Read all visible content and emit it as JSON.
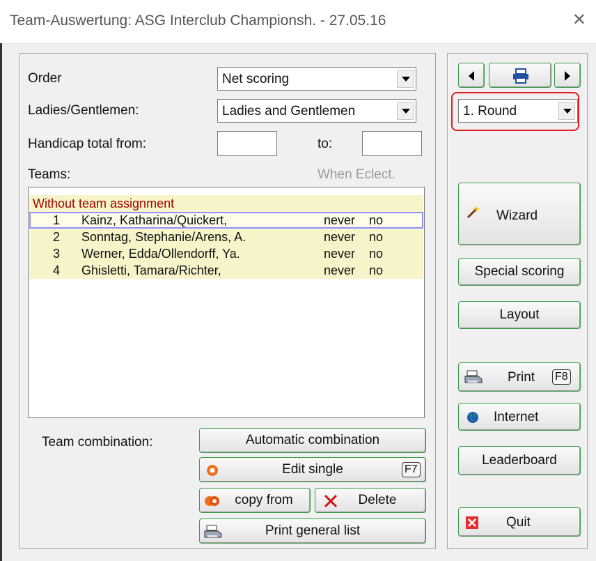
{
  "window": {
    "title": "Team-Auswertung: ASG Interclub Championsh. - 27.05.16",
    "close_glyph": "✕"
  },
  "form": {
    "order_label": "Order",
    "order_value": "Net scoring",
    "gender_label": "Ladies/Gentlemen:",
    "gender_value": "Ladies and Gentlemen",
    "handicap_label": "Handicap total from:",
    "handicap_from": "",
    "to_label": "to:",
    "handicap_to": ""
  },
  "teams": {
    "label": "Teams:",
    "when_eclect_label": "When Eclect.",
    "group_header": "Without team assignment",
    "rows": [
      {
        "num": "1",
        "name": "Kainz, Katharina/Quickert,",
        "when": "never",
        "eclect": "no"
      },
      {
        "num": "2",
        "name": "Sonntag, Stephanie/Arens, A.",
        "when": "never",
        "eclect": "no"
      },
      {
        "num": "3",
        "name": "Werner, Edda/Ollendorff, Ya.",
        "when": "never",
        "eclect": "no"
      },
      {
        "num": "4",
        "name": "Ghisletti, Tamara/Richter,",
        "when": "never",
        "eclect": "no"
      }
    ]
  },
  "combination": {
    "label": "Team combination:",
    "automatic": "Automatic combination",
    "edit_single": "Edit single",
    "edit_single_key": "F7",
    "copy_from": "copy from",
    "delete": "Delete",
    "print_general": "Print general list"
  },
  "side": {
    "round_value": "1. Round",
    "wizard": "Wizard",
    "special_scoring": "Special scoring",
    "layout": "Layout",
    "print": "Print",
    "print_key": "F8",
    "internet": "Internet",
    "leaderboard": "Leaderboard",
    "quit": "Quit"
  },
  "colors": {
    "accent_green": "#3a9b46",
    "highlight_red": "#e02020",
    "row_yellow": "#f6f4c8",
    "group_header_text": "#a00000"
  }
}
